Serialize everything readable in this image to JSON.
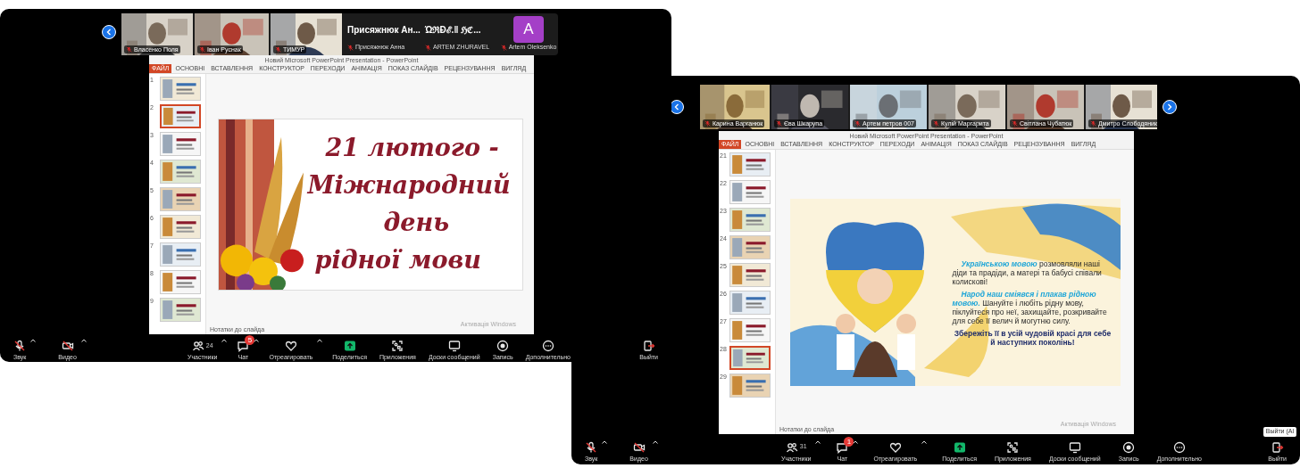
{
  "windows": [
    {
      "participants": [
        {
          "kind": "video",
          "name": "Власенко Поля"
        },
        {
          "kind": "video",
          "name": "Іван Руснак"
        },
        {
          "kind": "video",
          "name": "ТИМУР"
        },
        {
          "kind": "name",
          "title": "Присяжнюк Ан...",
          "name": "Присяжнюк Анна"
        },
        {
          "kind": "name",
          "title": "ΏℜÐℰ.‖ ℌℭ...",
          "name": "ARTEM ZHURAVEL"
        },
        {
          "kind": "avatar",
          "initial": "A",
          "name": "Artem Oleksenko"
        }
      ],
      "ppt": {
        "title": "Новий Microsoft PowerPoint Presentation - PowerPoint",
        "tabs": [
          {
            "label": "ФАЙЛ",
            "selected": true
          },
          {
            "label": "ОСНОВНІ",
            "selected": false
          },
          {
            "label": "ВСТАВЛЕННЯ",
            "selected": false
          },
          {
            "label": "КОНСТРУКТОР",
            "selected": false
          },
          {
            "label": "ПЕРЕХОДИ",
            "selected": false
          },
          {
            "label": "АНІМАЦІЯ",
            "selected": false
          },
          {
            "label": "ПОКАЗ СЛАЙДІВ",
            "selected": false
          },
          {
            "label": "РЕЦЕНЗУВАННЯ",
            "selected": false
          },
          {
            "label": "ВИГЛЯД",
            "selected": false
          }
        ],
        "thumbnails": [
          {
            "number": "1",
            "selected": false
          },
          {
            "number": "2",
            "selected": true
          },
          {
            "number": "3",
            "selected": false
          },
          {
            "number": "4",
            "selected": false
          },
          {
            "number": "5",
            "selected": false
          },
          {
            "number": "6",
            "selected": false
          },
          {
            "number": "7",
            "selected": false
          },
          {
            "number": "8",
            "selected": false
          },
          {
            "number": "9",
            "selected": false
          }
        ],
        "slide": {
          "kind": "title",
          "lines": [
            "21 лютого -",
            "Міжнародний",
            "день",
            "рідної мови"
          ]
        },
        "notes": "Нотатки до слайда",
        "watermark": "Активація Windows"
      },
      "toolbar": [
        {
          "label": "Звук",
          "caret": true
        },
        {
          "label": "Видео",
          "caret": true
        },
        {
          "label": "Участники",
          "count": "24",
          "caret": true
        },
        {
          "label": "Чат",
          "badge": "5",
          "caret": true
        },
        {
          "label": "Отреагировать",
          "caret": true
        },
        {
          "label": "Поделиться",
          "caret": false
        },
        {
          "label": "Приложения",
          "caret": false
        },
        {
          "label": "Доски сообщений",
          "caret": false
        },
        {
          "label": "Запись",
          "caret": false
        },
        {
          "label": "Дополнительно",
          "caret": false
        },
        {
          "label": "Выйти",
          "caret": false
        }
      ]
    },
    {
      "participants": [
        {
          "kind": "video",
          "name": "Карина Варганюк"
        },
        {
          "kind": "video",
          "name": "Єва Шкарупа"
        },
        {
          "kind": "video",
          "name": "Артем петров 007"
        },
        {
          "kind": "video",
          "name": "Кулій Маргарита"
        },
        {
          "kind": "video",
          "name": "Світлана Чубатюк"
        },
        {
          "kind": "video",
          "name": "Дмитро Слободяник"
        }
      ],
      "ppt": {
        "title": "Новий Microsoft PowerPoint Presentation - PowerPoint",
        "tabs": [
          {
            "label": "ФАЙЛ",
            "selected": true
          },
          {
            "label": "ОСНОВНІ",
            "selected": false
          },
          {
            "label": "ВСТАВЛЕННЯ",
            "selected": false
          },
          {
            "label": "КОНСТРУКТОР",
            "selected": false
          },
          {
            "label": "ПЕРЕХОДИ",
            "selected": false
          },
          {
            "label": "АНІМАЦІЯ",
            "selected": false
          },
          {
            "label": "ПОКАЗ СЛАЙДІВ",
            "selected": false
          },
          {
            "label": "РЕЦЕНЗУВАННЯ",
            "selected": false
          },
          {
            "label": "ВИГЛЯД",
            "selected": false
          }
        ],
        "thumbnails": [
          {
            "number": "21",
            "selected": false
          },
          {
            "number": "22",
            "selected": false
          },
          {
            "number": "23",
            "selected": false
          },
          {
            "number": "24",
            "selected": false
          },
          {
            "number": "25",
            "selected": false
          },
          {
            "number": "26",
            "selected": false
          },
          {
            "number": "27",
            "selected": false
          },
          {
            "number": "28",
            "selected": true
          },
          {
            "number": "29",
            "selected": false
          }
        ],
        "slide": {
          "kind": "poster",
          "paragraphs": [
            [
              {
                "text": "Українською мовою",
                "kind": "highlight"
              },
              {
                "text": " розмовляли наші діди та прадіди, а матері та бабусі співали колискові!",
                "kind": "plain"
              }
            ],
            [
              {
                "text": "Народ наш сміявся і плакав рідною мовою.",
                "kind": "highlight"
              },
              {
                "text": " Шануйте і любіть рідну мову, піклуйтеся про неї, захищайте, розкривайте для себе її велич й могутню силу.",
                "kind": "plain"
              }
            ],
            [
              {
                "text": "Збережіть її в усій чудовій красі для себе й наступних поколінь!",
                "kind": "strong"
              }
            ]
          ]
        },
        "notes": "Нотатки до слайда",
        "watermark": "Активація Windows"
      },
      "toolbar": [
        {
          "label": "Звук",
          "caret": true
        },
        {
          "label": "Видео",
          "caret": true
        },
        {
          "label": "Участники",
          "count": "31",
          "caret": true
        },
        {
          "label": "Чат",
          "badge": "1",
          "caret": true
        },
        {
          "label": "Отреагировать",
          "caret": true
        },
        {
          "label": "Поделиться",
          "caret": false
        },
        {
          "label": "Приложения",
          "caret": false
        },
        {
          "label": "Доски сообщений",
          "caret": false
        },
        {
          "label": "Запись",
          "caret": false
        },
        {
          "label": "Дополнительно",
          "caret": false
        },
        {
          "label": "Выйти",
          "caret": false
        }
      ],
      "tooltip": "Выйти (Al"
    }
  ]
}
